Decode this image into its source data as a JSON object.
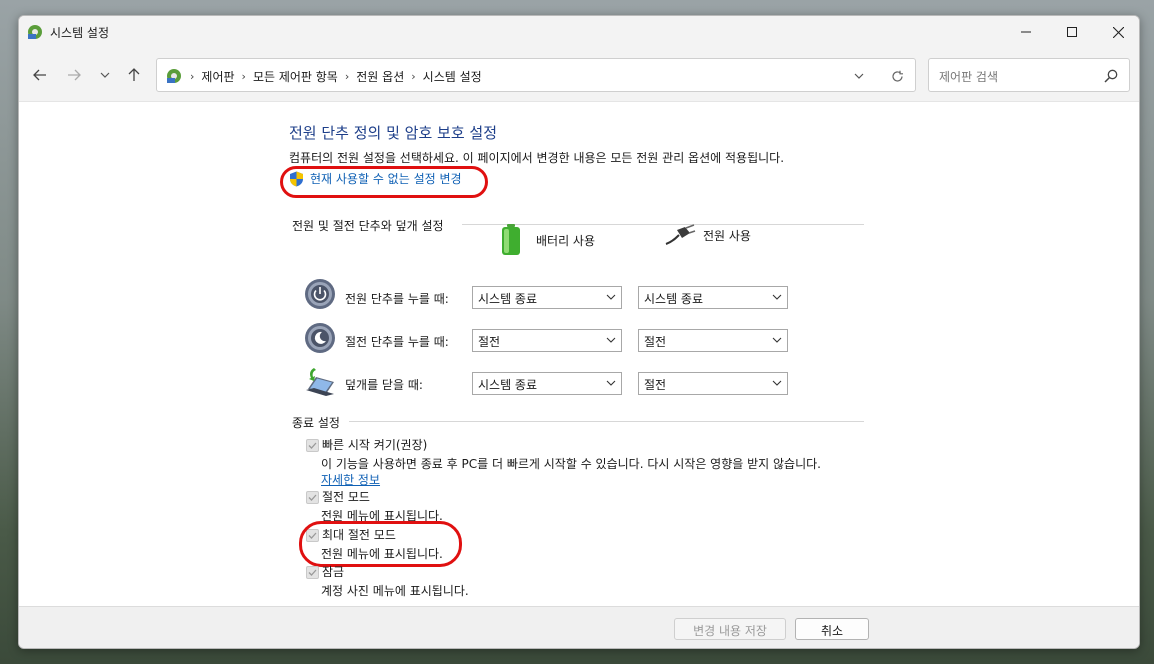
{
  "window": {
    "title": "시스템 설정"
  },
  "breadcrumbs": [
    "제어판",
    "모든 제어판 항목",
    "전원 옵션",
    "시스템 설정"
  ],
  "search": {
    "placeholder": "제어판 검색"
  },
  "main": {
    "heading": "전원 단추 정의 및 암호 보호 설정",
    "description": "컴퓨터의 전원 설정을 선택하세요. 이 페이지에서 변경한 내용은 모든 전원 관리 옵션에 적용됩니다.",
    "change_link": "현재 사용할 수 없는 설정 변경"
  },
  "power_buttons": {
    "group_label": "전원 및 절전 단추와 덮개 설정",
    "col_battery": "배터리 사용",
    "col_plugged": "전원 사용",
    "rows": [
      {
        "label": "전원 단추를 누를 때:",
        "battery": "시스템 종료",
        "plugged": "시스템 종료"
      },
      {
        "label": "절전 단추를 누를 때:",
        "battery": "절전",
        "plugged": "절전"
      },
      {
        "label": "덮개를 닫을 때:",
        "battery": "시스템 종료",
        "plugged": "절전"
      }
    ]
  },
  "shutdown": {
    "group_label": "종료 설정",
    "fast_startup": {
      "label": "빠른 시작 켜기(권장)",
      "desc": "이 기능을 사용하면 종료 후 PC를 더 빠르게 시작할 수 있습니다. 다시 시작은 영향을 받지 않습니다.",
      "link": "자세한 정보",
      "checked": true
    },
    "sleep": {
      "label": "절전 모드",
      "desc": "전원 메뉴에 표시됩니다.",
      "checked": true
    },
    "hibernate": {
      "label": "최대 절전 모드",
      "desc": "전원 메뉴에 표시됩니다.",
      "checked": true
    },
    "lock": {
      "label": "잠금",
      "desc": "계정 사진 메뉴에 표시됩니다.",
      "checked": true
    }
  },
  "footer": {
    "save_label": "변경 내용 저장",
    "cancel_label": "취소"
  },
  "colors": {
    "heading": "#1e3f8a",
    "link": "#1061b5",
    "highlight": "#e01010"
  }
}
